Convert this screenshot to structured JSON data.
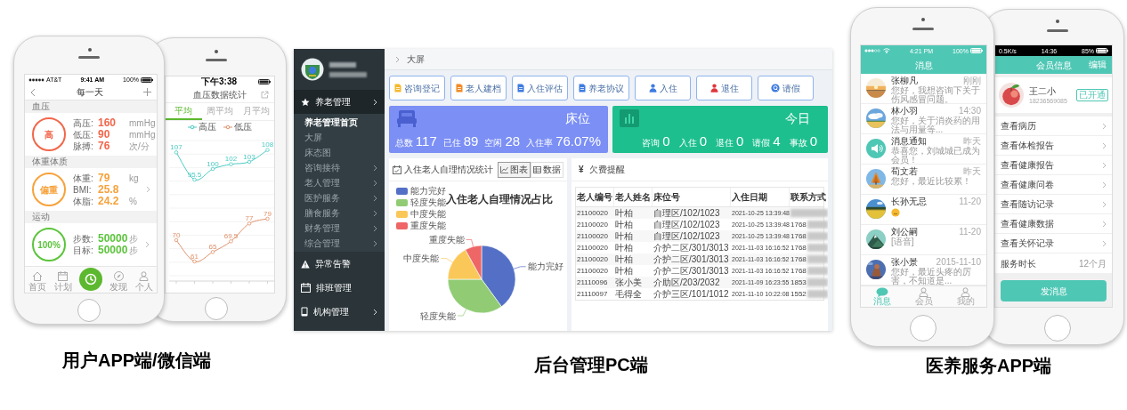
{
  "user_app": {
    "caption": "用户APP端/微信端",
    "daily_phone": {
      "status_bar": {
        "carrier": "AT&T",
        "time": "9:41 AM",
        "battery": "100%"
      },
      "title": "每一天",
      "sections": [
        {
          "heading": "血压",
          "badge": "高",
          "color": "#f2664a",
          "metrics": [
            {
              "label": "高压:",
              "value": "160",
              "unit": "mmHg"
            },
            {
              "label": "低压:",
              "value": "90",
              "unit": "mmHg"
            },
            {
              "label": "脉搏:",
              "value": "76",
              "unit": "次/分"
            }
          ]
        },
        {
          "heading": "体重体质",
          "badge": "偏重",
          "color": "#f7a23b",
          "metrics": [
            {
              "label": "体重:",
              "value": "79",
              "unit": "kg"
            },
            {
              "label": "BMI:",
              "value": "25.8"
            },
            {
              "label": "体脂:",
              "value": "24.2",
              "unit": "%"
            }
          ]
        },
        {
          "heading": "运动",
          "badge": "100%",
          "color": "#5cc43c",
          "metrics": [
            {
              "label": "步数:",
              "value": "50000",
              "unit": "步"
            },
            {
              "label": "目标:",
              "value": "50000",
              "unit": "步"
            }
          ]
        }
      ],
      "tab_bar": [
        {
          "kind": "tab",
          "label": "首页"
        },
        {
          "kind": "tab",
          "label": "计划"
        },
        {
          "kind": "action"
        },
        {
          "kind": "tab",
          "label": "发现"
        },
        {
          "kind": "tab",
          "label": "个人"
        }
      ]
    },
    "stats_phone": {
      "status_bar": {
        "time": "下午3:38"
      },
      "title": "血压数据统计",
      "tabs": [
        {
          "label": "平均",
          "selected": true
        },
        {
          "label": "周平均",
          "selected": false
        },
        {
          "label": "月平均",
          "selected": false
        }
      ],
      "chart_data": {
        "type": "line",
        "data_labels": true,
        "series": [
          {
            "name": "高压",
            "color": "#4ccbc3",
            "marker": "circle",
            "values": [
              107,
              95.5,
              100,
              102,
              103,
              108
            ]
          },
          {
            "name": "低压",
            "color": "#e0926c",
            "marker": "circle",
            "values": [
              70,
              61,
              65,
              69.5,
              77,
              79
            ]
          }
        ]
      }
    }
  },
  "admin_pc": {
    "caption": "后台管理PC端",
    "sidebar": [
      {
        "label": "养老管理",
        "has_submenu": true,
        "expanded": true,
        "children": [
          {
            "label": "养老管理首页",
            "selected": true,
            "has_submenu": false
          },
          {
            "label": "大屏",
            "selected": false,
            "has_submenu": false
          },
          {
            "label": "床态图",
            "selected": false,
            "has_submenu": false
          },
          {
            "label": "咨询接待",
            "selected": false,
            "has_submenu": true
          },
          {
            "label": "老人管理",
            "selected": false,
            "has_submenu": true
          },
          {
            "label": "医护服务",
            "selected": false,
            "has_submenu": true
          },
          {
            "label": "膳食服务",
            "selected": false,
            "has_submenu": true
          },
          {
            "label": "财务管理",
            "selected": false,
            "has_submenu": true
          },
          {
            "label": "综合管理",
            "selected": false,
            "has_submenu": true
          }
        ]
      },
      {
        "label": "异常告警",
        "has_submenu": false,
        "expanded": false
      },
      {
        "label": "排班管理",
        "has_submenu": false,
        "expanded": false
      },
      {
        "label": "机构管理",
        "has_submenu": true,
        "expanded": false
      }
    ],
    "breadcrumb": "大屏",
    "quick_actions": [
      {
        "label": "咨询登记",
        "color": "#f5b82e"
      },
      {
        "label": "老人建档",
        "color": "#f08a24"
      },
      {
        "label": "入住评估",
        "color": "#3d7be0"
      },
      {
        "label": "养老协议",
        "color": "#3d7be0"
      },
      {
        "label": "入住",
        "color": "#3d7be0"
      },
      {
        "label": "退住",
        "color": "#e0353b"
      },
      {
        "label": "请假",
        "color": "#3d7be0"
      }
    ],
    "bed_card": {
      "title": "床位",
      "stats": [
        {
          "label": "总数",
          "value": "117"
        },
        {
          "label": "已住",
          "value": "89"
        },
        {
          "label": "空闲",
          "value": "28"
        },
        {
          "label": "入住率",
          "value": "76.07%"
        }
      ]
    },
    "today_card": {
      "title": "今日",
      "stats": [
        {
          "label": "咨询",
          "value": "0"
        },
        {
          "label": "入住",
          "value": "0"
        },
        {
          "label": "退住",
          "value": "0"
        },
        {
          "label": "请假",
          "value": "4"
        },
        {
          "label": "事故",
          "value": "0"
        }
      ]
    },
    "care_stats": {
      "title": "入住老人自理情况统计",
      "view_toggle": [
        {
          "label": "图表",
          "selected": true
        },
        {
          "label": "数据",
          "selected": false
        }
      ],
      "chart_title": "入住老人自理情况占比",
      "legend": [
        {
          "label": "能力完好",
          "color": "#5470c6"
        },
        {
          "label": "轻度失能",
          "color": "#91cc75"
        },
        {
          "label": "中度失能",
          "color": "#fac858"
        },
        {
          "label": "重度失能",
          "color": "#ee6666"
        }
      ],
      "slice_labels": [
        "重度失能",
        "中度失能",
        "能力完好",
        "轻度失能"
      ]
    },
    "arrears": {
      "currency": "¥",
      "title": "欠费提醒",
      "columns": [
        "老人编号",
        "老人姓名",
        "床位号",
        "入住日期",
        "联系方式"
      ],
      "rows": [
        {
          "id": "21100020",
          "name": "叶柏",
          "bed": "自理区/102/1023",
          "date": "2021-10-25 13:39:48"
        },
        {
          "id": "21100020",
          "name": "叶柏",
          "bed": "自理区/102/1023",
          "date": "2021-10-25 13:39:48",
          "contact": "1768"
        },
        {
          "id": "21100020",
          "name": "叶柏",
          "bed": "自理区/102/1023",
          "date": "2021-10-25 13:39:48",
          "contact": "1768"
        },
        {
          "id": "21100020",
          "name": "叶柏",
          "bed": "介护二区/301/3013",
          "date": "2021-11-03 16:16:52",
          "contact": "1768"
        },
        {
          "id": "21100020",
          "name": "叶柏",
          "bed": "介护二区/301/3013",
          "date": "2021-11-03 16:16:52",
          "contact": "1768"
        },
        {
          "id": "21100020",
          "name": "叶柏",
          "bed": "介护二区/301/3013",
          "date": "2021-11-03 16:16:52",
          "contact": "1768"
        },
        {
          "id": "21110096",
          "name": "张小美",
          "bed": "介助区/203/2032",
          "date": "2021-11-09 16:23:55",
          "contact": "1853"
        },
        {
          "id": "21110097",
          "name": "毛得全",
          "bed": "介护三区/101/1012",
          "date": "2021-11-10 10:22:08",
          "contact": "1552"
        }
      ]
    }
  },
  "care_app": {
    "caption": "医养服务APP端",
    "messages_phone": {
      "status_bar": {
        "time": "4:21 PM",
        "battery": "100%"
      },
      "title": "消息",
      "messages": [
        {
          "kind": "chat",
          "name": "张柳凡",
          "time": "刚刚",
          "preview": "您好，我想咨询下关于伤风感冒问题。"
        },
        {
          "kind": "chat",
          "name": "林小羽",
          "time": "14:30",
          "preview": "您好，关于消炎药的用法与用量等..."
        },
        {
          "kind": "notice",
          "name": "消息通知",
          "time": "昨天",
          "preview": "恭喜您，刘城城已成为会员！"
        },
        {
          "kind": "chat",
          "name": "荀文若",
          "time": "昨天",
          "preview": "您好，最近比较累！"
        },
        {
          "kind": "emoji",
          "name": "长孙无忌",
          "time": "11-20"
        },
        {
          "kind": "chat",
          "name": "刘公嗣",
          "time": "11-20",
          "preview": "[语音]"
        },
        {
          "kind": "chat",
          "name": "张小景",
          "time": "2015-11-10",
          "preview": "您好，最近头疼的厉害，不知道是..."
        }
      ],
      "tabs": [
        {
          "label": "消息",
          "selected": true
        },
        {
          "label": "会员",
          "selected": false
        },
        {
          "label": "我的",
          "selected": false
        }
      ]
    },
    "member_phone": {
      "status_bar": {
        "speed": "0.5K/s",
        "time": "14:36",
        "battery": "85%"
      },
      "title": "会员信息",
      "action": "编辑",
      "member": {
        "name": "王二小",
        "phone": "18236569085",
        "badge": "已开通"
      },
      "menu": [
        {
          "kind": "link",
          "label": "查看病历"
        },
        {
          "kind": "link",
          "label": "查看体检报告"
        },
        {
          "kind": "link",
          "label": "查看健康报告"
        },
        {
          "kind": "link",
          "label": "查看健康问卷"
        },
        {
          "kind": "link",
          "label": "查看随访记录"
        },
        {
          "kind": "link",
          "label": "查看健康数据"
        },
        {
          "kind": "link",
          "label": "查看关怀记录"
        },
        {
          "kind": "info",
          "label": "服务时长",
          "value": "12个月"
        }
      ],
      "button": "发消息"
    }
  }
}
